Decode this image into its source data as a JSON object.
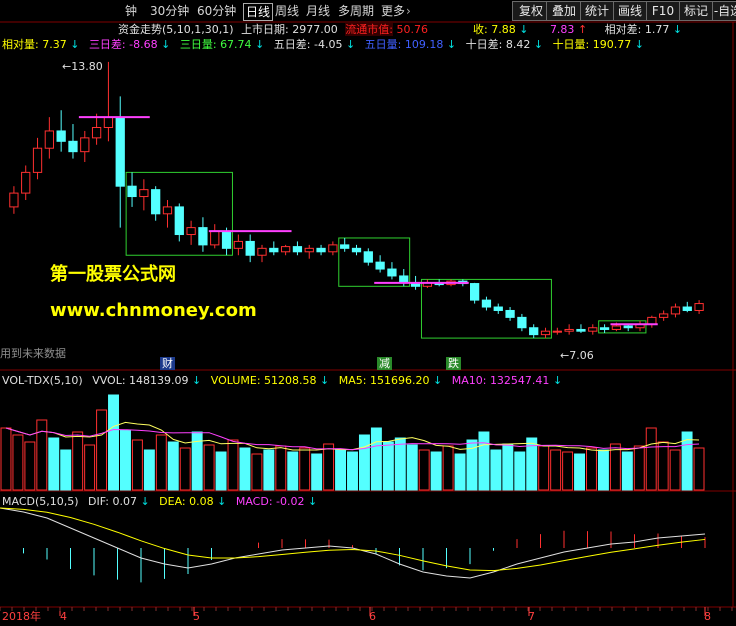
{
  "toolbar": {
    "periods": [
      "钟",
      "30分钟",
      "60分钟",
      "日线",
      "周线",
      "月线",
      "多周期",
      "更多"
    ],
    "active_period": "日线",
    "more_arrow": "›",
    "buttons": [
      "复权",
      "叠加",
      "统计",
      "画线",
      "F10",
      "标记",
      "-自选"
    ]
  },
  "main_panel": {
    "indicator_name": "资金走势(5,10,1,30,1)",
    "listing_days_label": "上市日期:",
    "listing_days_value": "2977.00",
    "float_cap_label": "流通市值:",
    "float_cap_value": "50.76",
    "close_label": "收:",
    "close_value": "7.88",
    "extra_value": "7.83",
    "rel_diff_label": "相对差:",
    "rel_diff_value": "1.77",
    "rel_vol_label": "相对量:",
    "rel_vol_value": "7.37",
    "d3_diff_label": "三日差:",
    "d3_diff_value": "-8.68",
    "d3_vol_label": "三日量:",
    "d3_vol_value": "67.74",
    "d5_diff_label": "五日差:",
    "d5_diff_value": "-4.05",
    "d5_vol_label": "五日量:",
    "d5_vol_value": "109.18",
    "d10_diff_label": "十日差:",
    "d10_diff_value": "8.42",
    "d10_vol_label": "十日量:",
    "d10_vol_value": "190.77",
    "high_mark": "13.80",
    "low_mark": "7.06",
    "future_data_note": "用到未来数据",
    "event_tags": [
      "财",
      "减",
      "跌"
    ],
    "banner_title": "第一股票公式网",
    "banner_url": "www.chnmoney.com"
  },
  "volume_panel": {
    "name": "VOL-TDX(5,10)",
    "vvol_label": "VVOL:",
    "vvol_value": "148139.09",
    "volume_label": "VOLUME:",
    "volume_value": "51208.58",
    "ma5_label": "MA5:",
    "ma5_value": "151696.20",
    "ma10_label": "MA10:",
    "ma10_value": "132547.41"
  },
  "macd_panel": {
    "name": "MACD(5,10,5)",
    "dif_label": "DIF:",
    "dif_value": "0.07",
    "dea_label": "DEA:",
    "dea_value": "0.08",
    "macd_label": "MACD:",
    "macd_value": "-0.02"
  },
  "time_axis": {
    "labels": [
      "2018年",
      "4",
      "5",
      "6",
      "7",
      "8"
    ]
  },
  "colors": {
    "up": "#ff3030",
    "down": "#54ffff",
    "box": "#30d030",
    "magenta": "#ff40ff",
    "yellow": "#ffff00",
    "grid": "#800000"
  },
  "chart_data": {
    "type": "candlestick",
    "candles": [
      {
        "o": 9.6,
        "h": 10.2,
        "l": 9.4,
        "c": 10.0
      },
      {
        "o": 10.0,
        "h": 10.8,
        "l": 9.8,
        "c": 10.6
      },
      {
        "o": 10.6,
        "h": 11.6,
        "l": 10.4,
        "c": 11.3
      },
      {
        "o": 11.3,
        "h": 12.2,
        "l": 11.0,
        "c": 11.8
      },
      {
        "o": 11.8,
        "h": 12.4,
        "l": 11.2,
        "c": 11.5
      },
      {
        "o": 11.5,
        "h": 12.0,
        "l": 11.0,
        "c": 11.2
      },
      {
        "o": 11.2,
        "h": 11.8,
        "l": 10.9,
        "c": 11.6
      },
      {
        "o": 11.6,
        "h": 12.3,
        "l": 11.4,
        "c": 11.9
      },
      {
        "o": 11.9,
        "h": 13.8,
        "l": 11.5,
        "c": 12.2
      },
      {
        "o": 12.2,
        "h": 12.8,
        "l": 9.0,
        "c": 10.2
      },
      {
        "o": 10.2,
        "h": 10.6,
        "l": 9.6,
        "c": 9.9
      },
      {
        "o": 9.9,
        "h": 10.4,
        "l": 9.5,
        "c": 10.1
      },
      {
        "o": 10.1,
        "h": 10.2,
        "l": 9.2,
        "c": 9.4
      },
      {
        "o": 9.4,
        "h": 9.8,
        "l": 9.0,
        "c": 9.6
      },
      {
        "o": 9.6,
        "h": 9.7,
        "l": 8.6,
        "c": 8.8
      },
      {
        "o": 8.8,
        "h": 9.2,
        "l": 8.5,
        "c": 9.0
      },
      {
        "o": 9.0,
        "h": 9.3,
        "l": 8.3,
        "c": 8.5
      },
      {
        "o": 8.5,
        "h": 9.1,
        "l": 8.4,
        "c": 8.9
      },
      {
        "o": 8.9,
        "h": 9.0,
        "l": 8.2,
        "c": 8.4
      },
      {
        "o": 8.4,
        "h": 8.8,
        "l": 8.2,
        "c": 8.6
      },
      {
        "o": 8.6,
        "h": 8.8,
        "l": 8.0,
        "c": 8.2
      },
      {
        "o": 8.2,
        "h": 8.5,
        "l": 8.0,
        "c": 8.4
      },
      {
        "o": 8.4,
        "h": 8.6,
        "l": 8.2,
        "c": 8.3
      },
      {
        "o": 8.3,
        "h": 8.5,
        "l": 8.2,
        "c": 8.45
      },
      {
        "o": 8.45,
        "h": 8.6,
        "l": 8.2,
        "c": 8.3
      },
      {
        "o": 8.3,
        "h": 8.5,
        "l": 8.1,
        "c": 8.4
      },
      {
        "o": 8.4,
        "h": 8.5,
        "l": 8.2,
        "c": 8.3
      },
      {
        "o": 8.3,
        "h": 8.6,
        "l": 8.2,
        "c": 8.5
      },
      {
        "o": 8.5,
        "h": 8.7,
        "l": 8.3,
        "c": 8.4
      },
      {
        "o": 8.4,
        "h": 8.5,
        "l": 8.2,
        "c": 8.3
      },
      {
        "o": 8.3,
        "h": 8.4,
        "l": 7.9,
        "c": 8.0
      },
      {
        "o": 8.0,
        "h": 8.2,
        "l": 7.7,
        "c": 7.8
      },
      {
        "o": 7.8,
        "h": 8.0,
        "l": 7.5,
        "c": 7.6
      },
      {
        "o": 7.6,
        "h": 7.8,
        "l": 7.3,
        "c": 7.4
      },
      {
        "o": 7.4,
        "h": 7.6,
        "l": 7.2,
        "c": 7.3
      },
      {
        "o": 7.3,
        "h": 7.5,
        "l": 7.25,
        "c": 7.4
      },
      {
        "o": 7.4,
        "h": 7.5,
        "l": 7.3,
        "c": 7.35
      },
      {
        "o": 7.35,
        "h": 7.5,
        "l": 7.3,
        "c": 7.45
      },
      {
        "o": 7.45,
        "h": 7.5,
        "l": 7.3,
        "c": 7.38
      },
      {
        "o": 7.38,
        "h": 7.4,
        "l": 6.8,
        "c": 6.9
      },
      {
        "o": 6.9,
        "h": 7.0,
        "l": 6.6,
        "c": 6.7
      },
      {
        "o": 6.7,
        "h": 6.8,
        "l": 6.5,
        "c": 6.6
      },
      {
        "o": 6.6,
        "h": 6.7,
        "l": 6.3,
        "c": 6.4
      },
      {
        "o": 6.4,
        "h": 6.5,
        "l": 6.0,
        "c": 6.1
      },
      {
        "o": 6.1,
        "h": 6.2,
        "l": 5.8,
        "c": 5.9
      },
      {
        "o": 5.9,
        "h": 6.1,
        "l": 5.8,
        "c": 6.0
      },
      {
        "o": 6.0,
        "h": 6.1,
        "l": 5.9,
        "c": 6.0
      },
      {
        "o": 6.0,
        "h": 6.2,
        "l": 5.9,
        "c": 6.05
      },
      {
        "o": 6.05,
        "h": 6.2,
        "l": 5.95,
        "c": 6.0
      },
      {
        "o": 6.0,
        "h": 6.2,
        "l": 5.9,
        "c": 6.1
      },
      {
        "o": 6.1,
        "h": 6.2,
        "l": 5.95,
        "c": 6.05
      },
      {
        "o": 6.05,
        "h": 6.25,
        "l": 6.0,
        "c": 6.15
      },
      {
        "o": 6.15,
        "h": 6.2,
        "l": 6.0,
        "c": 6.1
      },
      {
        "o": 6.1,
        "h": 6.3,
        "l": 6.0,
        "c": 6.2
      },
      {
        "o": 6.2,
        "h": 6.45,
        "l": 6.1,
        "c": 6.4
      },
      {
        "o": 6.4,
        "h": 6.6,
        "l": 6.3,
        "c": 6.5
      },
      {
        "o": 6.5,
        "h": 6.8,
        "l": 6.4,
        "c": 6.7
      },
      {
        "o": 6.7,
        "h": 6.85,
        "l": 6.55,
        "c": 6.6
      },
      {
        "o": 6.6,
        "h": 6.9,
        "l": 6.5,
        "c": 6.8
      }
    ],
    "volume": [
      62,
      55,
      48,
      70,
      52,
      40,
      58,
      45,
      80,
      95,
      60,
      50,
      40,
      55,
      48,
      42,
      58,
      45,
      38,
      50,
      42,
      36,
      40,
      44,
      38,
      42,
      36,
      46,
      40,
      38,
      55,
      62,
      48,
      52,
      45,
      40,
      38,
      44,
      36,
      50,
      58,
      40,
      46,
      38,
      52,
      44,
      40,
      38,
      36,
      42,
      40,
      46,
      38,
      44,
      62,
      48,
      40,
      58,
      42
    ],
    "macd": {
      "dif": [
        0.2,
        0.18,
        0.15,
        0.1,
        0.05,
        0.0,
        -0.05,
        -0.08,
        -0.1,
        -0.08,
        -0.05,
        -0.03,
        -0.01,
        0.0,
        0.01,
        0.0,
        -0.03,
        -0.08,
        -0.12,
        -0.14,
        -0.15,
        -0.12,
        -0.08,
        -0.05,
        -0.02,
        0.0,
        0.02,
        0.03,
        0.05,
        0.06,
        0.07
      ]
    }
  }
}
